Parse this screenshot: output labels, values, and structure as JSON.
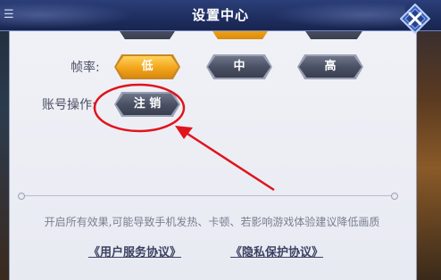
{
  "titlebar": {
    "title": "设置中心",
    "menu_icon": "menu-icon",
    "close_icon": "close-icon"
  },
  "settings": {
    "frame_rate": {
      "label": "帧率:",
      "options": [
        {
          "label": "低",
          "selected": true
        },
        {
          "label": "中",
          "selected": false
        },
        {
          "label": "高",
          "selected": false
        }
      ]
    },
    "account": {
      "label": "账号操作:",
      "logout_label": "注 销"
    }
  },
  "notice": "开启所有效果,可能导致手机发热、卡顿、若影响游戏体验建议降低画质",
  "links": {
    "user_agreement": "《用户服务协议》",
    "privacy_agreement": "《隐私保护协议》"
  },
  "colors": {
    "title_bar": "#1f2f62",
    "selected_option": "#f2a51c",
    "unselected_option": "#4b5164",
    "annotation": "#e0141c"
  }
}
